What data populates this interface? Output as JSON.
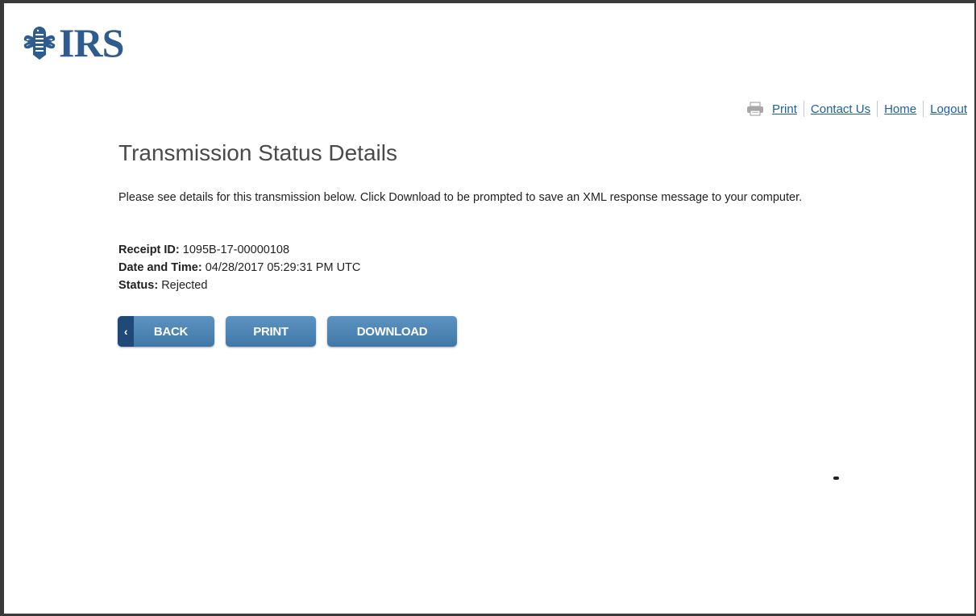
{
  "logo": {
    "text": "IRS",
    "icon": "irs-eagle-logo"
  },
  "utility_nav": {
    "print_icon": "printer-icon",
    "print": "Print",
    "contact": "Contact Us",
    "home": "Home",
    "logout": "Logout",
    "link_color": "#1f5f9e"
  },
  "main": {
    "title": "Transmission Status Details",
    "intro": "Please see details for this transmission below. Click Download to be prompted to save an XML response message to your computer.",
    "details": {
      "receipt_label": "Receipt ID:",
      "receipt_value": "1095B-17-00000108",
      "datetime_label": "Date and Time:",
      "datetime_value": "04/28/2017 05:29:31 PM UTC",
      "status_label": "Status:",
      "status_value": "Rejected"
    },
    "buttons": {
      "back": "BACK",
      "print": "PRINT",
      "download": "DOWNLOAD",
      "color": "#4a80b0"
    }
  }
}
